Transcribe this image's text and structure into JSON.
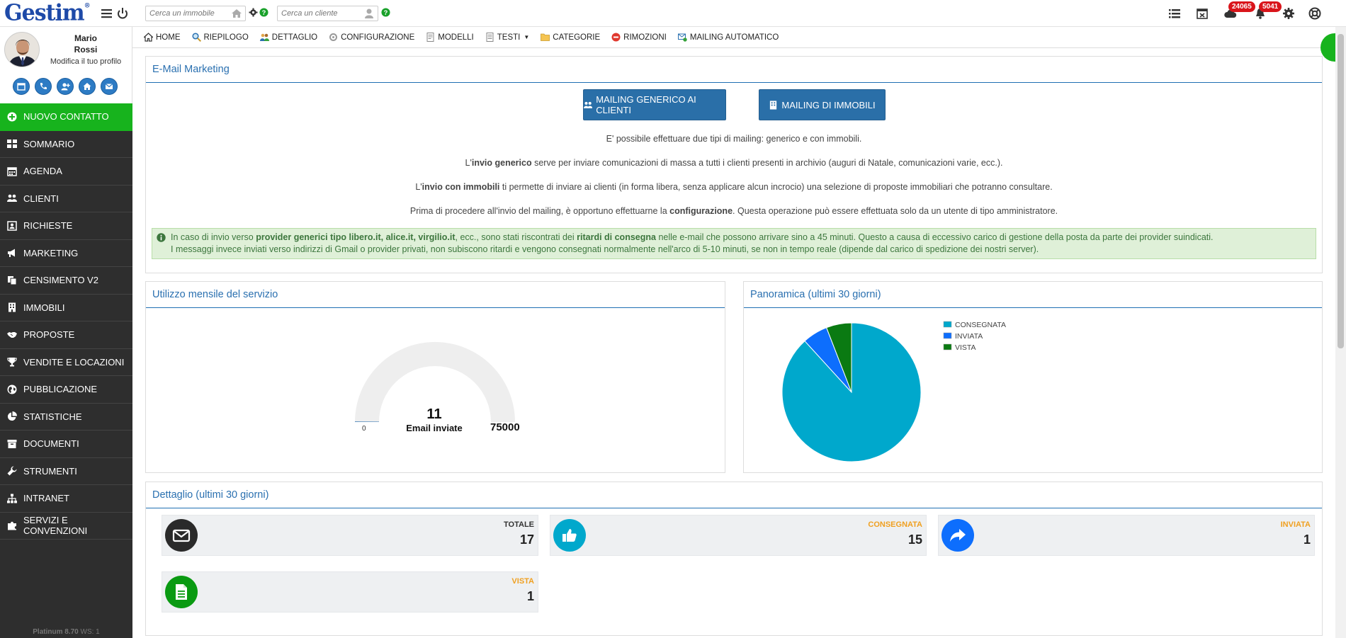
{
  "app": {
    "logo": "Gestim"
  },
  "topbar": {
    "search_property_placeholder": "Cerca un immobile",
    "search_client_placeholder": "Cerca un cliente",
    "badge_cloud": "24065",
    "badge_bell": "5041"
  },
  "profile": {
    "first_name": "Mario",
    "last_name": "Rossi",
    "edit_label": "Modifica il tuo profilo"
  },
  "sidebar": {
    "items": [
      {
        "label": "NUOVO CONTATTO",
        "icon": "plus-circle-icon"
      },
      {
        "label": "SOMMARIO",
        "icon": "grid-icon"
      },
      {
        "label": "AGENDA",
        "icon": "calendar-icon"
      },
      {
        "label": "CLIENTI",
        "icon": "users-icon"
      },
      {
        "label": "RICHIESTE",
        "icon": "contact-card-icon"
      },
      {
        "label": "MARKETING",
        "icon": "megaphone-icon"
      },
      {
        "label": "CENSIMENTO V2",
        "icon": "copy-icon"
      },
      {
        "label": "IMMOBILI",
        "icon": "building-icon"
      },
      {
        "label": "PROPOSTE",
        "icon": "handshake-icon"
      },
      {
        "label": "VENDITE E LOCAZIONI",
        "icon": "trophy-icon"
      },
      {
        "label": "PUBBLICAZIONE",
        "icon": "globe-icon"
      },
      {
        "label": "STATISTICHE",
        "icon": "pie-chart-icon"
      },
      {
        "label": "DOCUMENTI",
        "icon": "archive-icon"
      },
      {
        "label": "STRUMENTI",
        "icon": "wrench-icon"
      },
      {
        "label": "INTRANET",
        "icon": "sitemap-icon"
      },
      {
        "label": "SERVIZI E CONVENZIONI",
        "icon": "puzzle-icon"
      }
    ],
    "version_label": "Platinum 8.70",
    "ws_label": "WS: 1"
  },
  "menu": {
    "items": [
      {
        "label": "HOME"
      },
      {
        "label": "RIEPILOGO"
      },
      {
        "label": "DETTAGLIO"
      },
      {
        "label": "CONFIGURAZIONE"
      },
      {
        "label": "MODELLI"
      },
      {
        "label": "TESTI"
      },
      {
        "label": "CATEGORIE"
      },
      {
        "label": "RIMOZIONI"
      },
      {
        "label": "MAILING AUTOMATICO"
      }
    ]
  },
  "email_marketing": {
    "title": "E-Mail Marketing",
    "btn_generic": "MAILING GENERICO AI CLIENTI",
    "btn_properties": "MAILING DI IMMOBILI",
    "p1": "E' possibile effettuare due tipi di mailing: generico e con immobili.",
    "p2_pre": "L'",
    "p2_bold": "invio generico",
    "p2_post": " serve per inviare comunicazioni di massa a tutti i clienti presenti in archivio (auguri di Natale, comunicazioni varie, ecc.).",
    "p3_pre": "L'",
    "p3_bold": "invio con immobili",
    "p3_post": " ti permette di inviare ai clienti (in forma libera, senza applicare alcun incrocio) una selezione di proposte immobiliari che potranno consultare.",
    "p4_pre": "Prima di procedere all'invio del mailing, è opportuno effettuarne la ",
    "p4_bold": "configurazione",
    "p4_post": ". Questa operazione può essere effettuata solo da un utente di tipo amministratore.",
    "alert_1": "In caso di invio verso ",
    "alert_2": "provider generici tipo libero.it, alice.it, virgilio.it",
    "alert_3": ", ecc., sono stati riscontrati dei ",
    "alert_4": "ritardi di consegna",
    "alert_5": " nelle e-mail che possono arrivare sino a 45 minuti. Questo a causa di eccessivo carico di gestione della posta da parte dei provider suindicati.",
    "alert_line2": "I messaggi invece inviati verso indirizzi di Gmail o provider privati, non subiscono ritardi e vengono consegnati normalmente nell'arco di 5-10 minuti, se non in tempo reale (dipende dal carico di spedizione dei nostri server)."
  },
  "usage": {
    "title": "Utilizzo mensile del servizio",
    "value": 11,
    "value_label": "11",
    "caption": "Email inviate",
    "min": 0,
    "min_label": "0",
    "max": 75000,
    "max_label": "75000"
  },
  "chart_data": {
    "type": "pie",
    "title": "Panoramica (ultimi 30 giorni)",
    "categories": [
      "CONSEGNATA",
      "INVIATA",
      "VISTA"
    ],
    "values": [
      15,
      1,
      1
    ],
    "colors": [
      "#00a8cc",
      "#0d6efd",
      "#0a7a12"
    ],
    "legend_position": "right"
  },
  "detail": {
    "title": "Dettaglio (ultimi 30 giorni)",
    "stats": [
      {
        "label": "TOTALE",
        "value": "17",
        "icon": "envelope-icon",
        "color": "#2a2a2a",
        "label_color": "#333333"
      },
      {
        "label": "CONSEGNATA",
        "value": "15",
        "icon": "thumbs-up-icon",
        "color": "#00a8cc",
        "label_color": "#f0a020"
      },
      {
        "label": "INVIATA",
        "value": "1",
        "icon": "share-icon",
        "color": "#0d6efd",
        "label_color": "#f0a020"
      },
      {
        "label": "VISTA",
        "value": "1",
        "icon": "document-icon",
        "color": "#0a9a12",
        "label_color": "#f0a020"
      }
    ]
  }
}
